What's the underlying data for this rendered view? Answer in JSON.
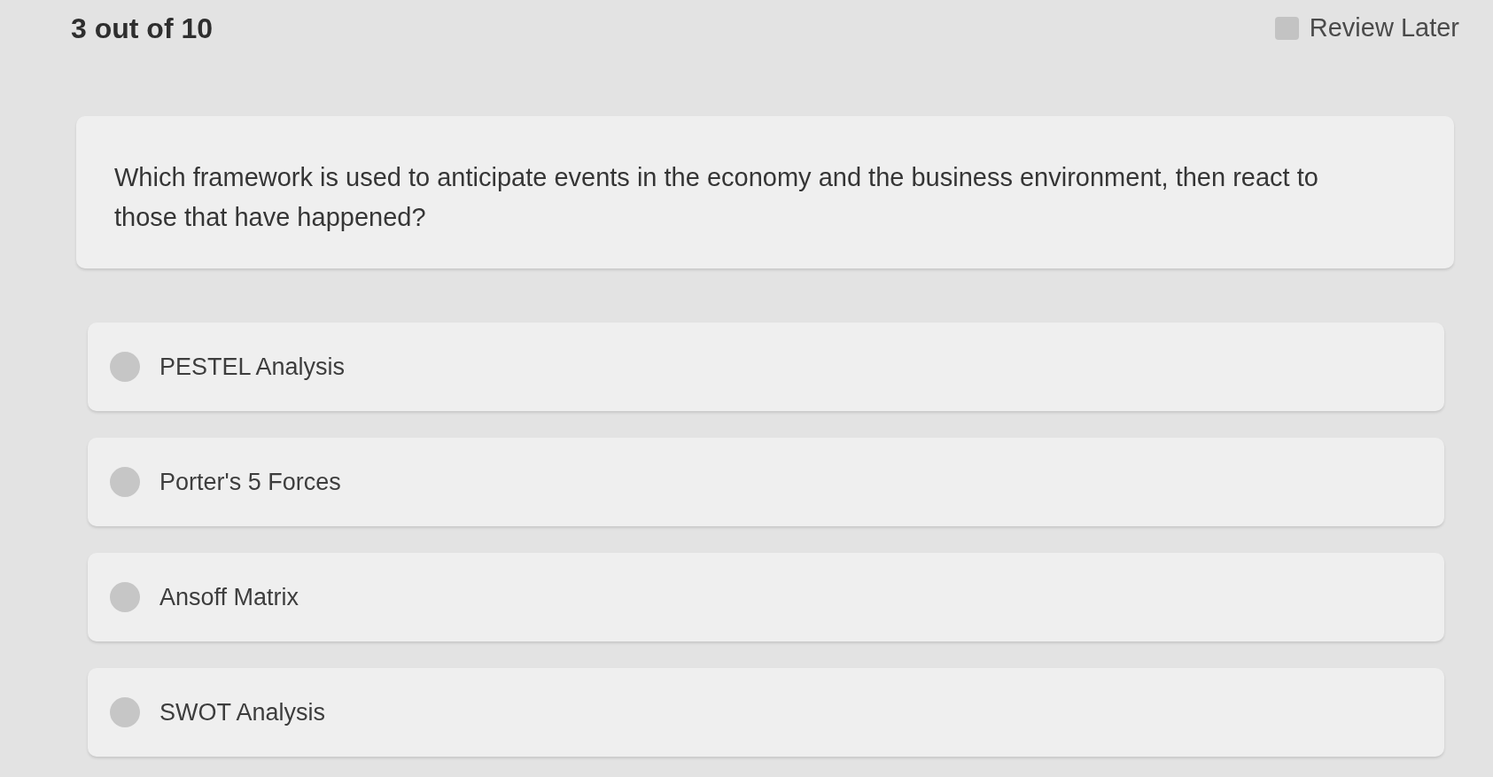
{
  "header": {
    "progress": "3 out of 10",
    "review_later": {
      "label": "Review Later",
      "checked": false
    }
  },
  "question": {
    "text": "Which framework is used to anticipate events in the economy and the business environment, then react to those that have happened?"
  },
  "options": [
    {
      "label": "PESTEL Analysis",
      "selected": false
    },
    {
      "label": "Porter's 5 Forces",
      "selected": false
    },
    {
      "label": "Ansoff Matrix",
      "selected": false
    },
    {
      "label": "SWOT Analysis",
      "selected": false
    }
  ]
}
